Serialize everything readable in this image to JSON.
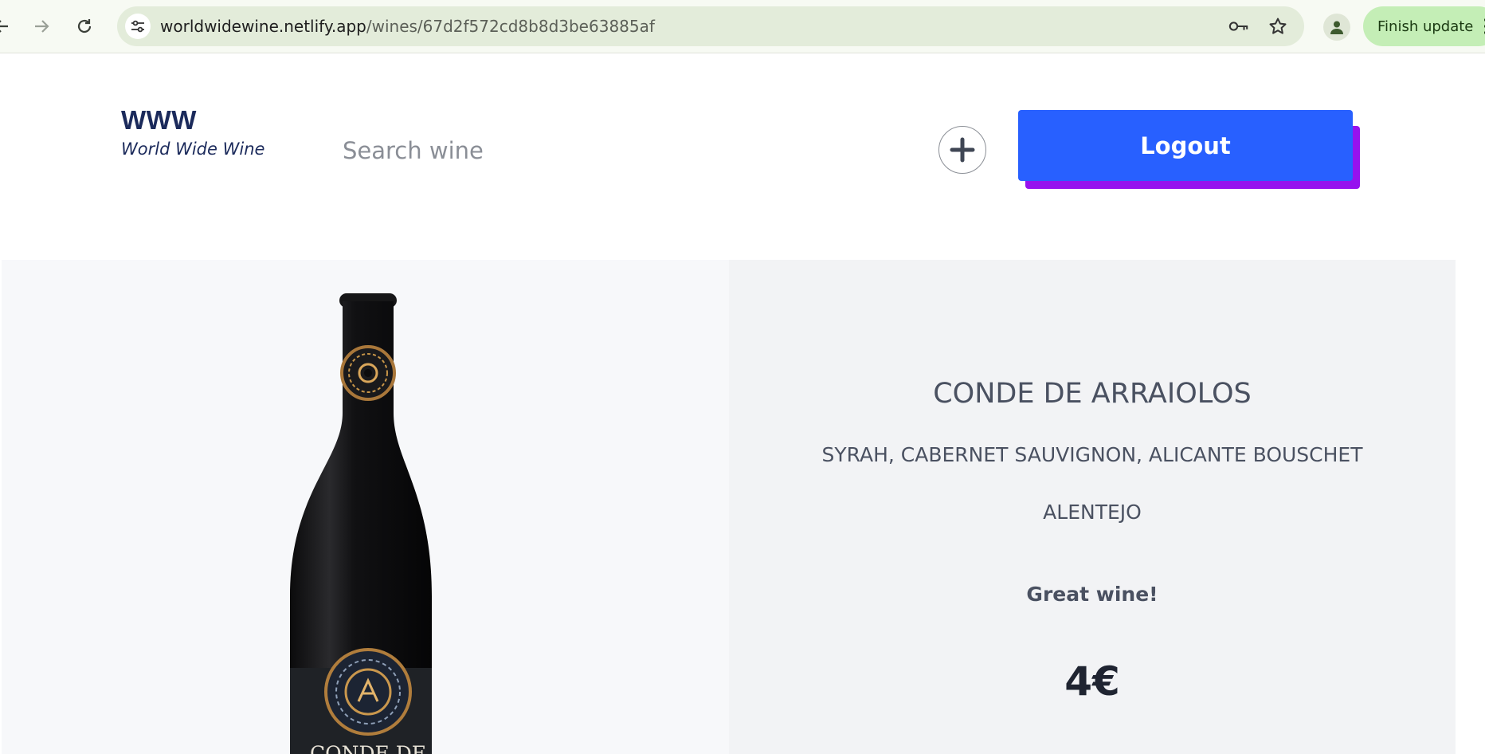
{
  "browser": {
    "url_host": "worldwidewine.netlify.app",
    "url_path": "/wines/67d2f572cd8b8d3be63885af",
    "finish_update_label": "Finish update",
    "icons": {
      "back": "arrow-left-icon",
      "forward": "arrow-right-icon",
      "reload": "reload-icon",
      "site_info": "tune-icon",
      "passwords": "key-icon",
      "bookmark": "star-icon",
      "profile": "person-icon",
      "menu": "kebab-menu-icon"
    }
  },
  "header": {
    "logo_title": "WWW",
    "logo_subtitle": "World Wide Wine",
    "search_placeholder": "Search wine",
    "add_icon": "plus-circle-icon",
    "logout_label": "Logout"
  },
  "wine": {
    "bottle_label": "CONDE DE",
    "name": "CONDE DE ARRAIOLOS",
    "grapes": "SYRAH, CABERNET SAUVIGNON, ALICANTE BOUSCHET",
    "region": "ALENTEJO",
    "review": "Great wine!",
    "price": "4€"
  },
  "colors": {
    "logout_bg": "#2860ff",
    "logout_shadow": "#9612ee",
    "logo_text": "#1b2a5b",
    "finish_update_bg": "#c4eeb6",
    "omnibox_bg": "#e3ecda"
  }
}
